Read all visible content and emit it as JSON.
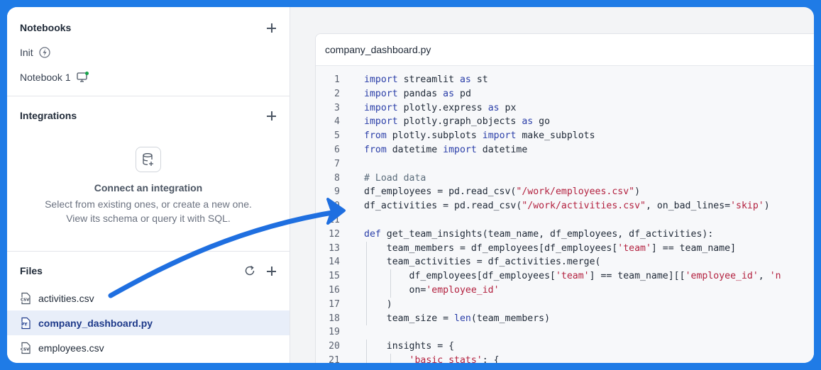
{
  "sidebar": {
    "notebooks": {
      "title": "Notebooks",
      "items": [
        {
          "label": "Init",
          "icon": "lightning-icon"
        },
        {
          "label": "Notebook 1",
          "icon": "monitor-icon"
        }
      ]
    },
    "integrations": {
      "title": "Integrations",
      "empty_title": "Connect an integration",
      "empty_line1": "Select from existing ones, or create a new one.",
      "empty_line2": "View its schema or query it with SQL."
    },
    "files": {
      "title": "Files",
      "items": [
        {
          "label": "activities.csv",
          "type": "csv"
        },
        {
          "label": "company_dashboard.py",
          "type": "py"
        },
        {
          "label": "employees.csv",
          "type": "csv"
        }
      ]
    }
  },
  "editor": {
    "filename": "company_dashboard.py",
    "lines": [
      {
        "n": "1",
        "code": "import streamlit as st"
      },
      {
        "n": "2",
        "code": "import pandas as pd"
      },
      {
        "n": "3",
        "code": "import plotly.express as px"
      },
      {
        "n": "4",
        "code": "import plotly.graph_objects as go"
      },
      {
        "n": "5",
        "code": "from plotly.subplots import make_subplots"
      },
      {
        "n": "6",
        "code": "from datetime import datetime"
      },
      {
        "n": "7",
        "code": ""
      },
      {
        "n": "8",
        "code": "# Load data"
      },
      {
        "n": "9",
        "code": "df_employees = pd.read_csv(\"/work/employees.csv\")"
      },
      {
        "n": "10",
        "code": "df_activities = pd.read_csv(\"/work/activities.csv\", on_bad_lines='skip')"
      },
      {
        "n": "11",
        "code": ""
      },
      {
        "n": "12",
        "code": "def get_team_insights(team_name, df_employees, df_activities):"
      },
      {
        "n": "13",
        "code": "    team_members = df_employees[df_employees['team'] == team_name]"
      },
      {
        "n": "14",
        "code": "    team_activities = df_activities.merge("
      },
      {
        "n": "15",
        "code": "        df_employees[df_employees['team'] == team_name][['employee_id', 'n"
      },
      {
        "n": "16",
        "code": "        on='employee_id'"
      },
      {
        "n": "17",
        "code": "    )"
      },
      {
        "n": "18",
        "code": "    team_size = len(team_members)"
      },
      {
        "n": "19",
        "code": ""
      },
      {
        "n": "20",
        "code": "    insights = {"
      },
      {
        "n": "21",
        "code": "        'basic_stats': {"
      }
    ]
  },
  "colors": {
    "background": "#1f7be6",
    "arrow": "#1f6fe0",
    "keyword": "#2a3ea8",
    "string": "#b3213f",
    "active_file_bg": "#e8eef9"
  }
}
